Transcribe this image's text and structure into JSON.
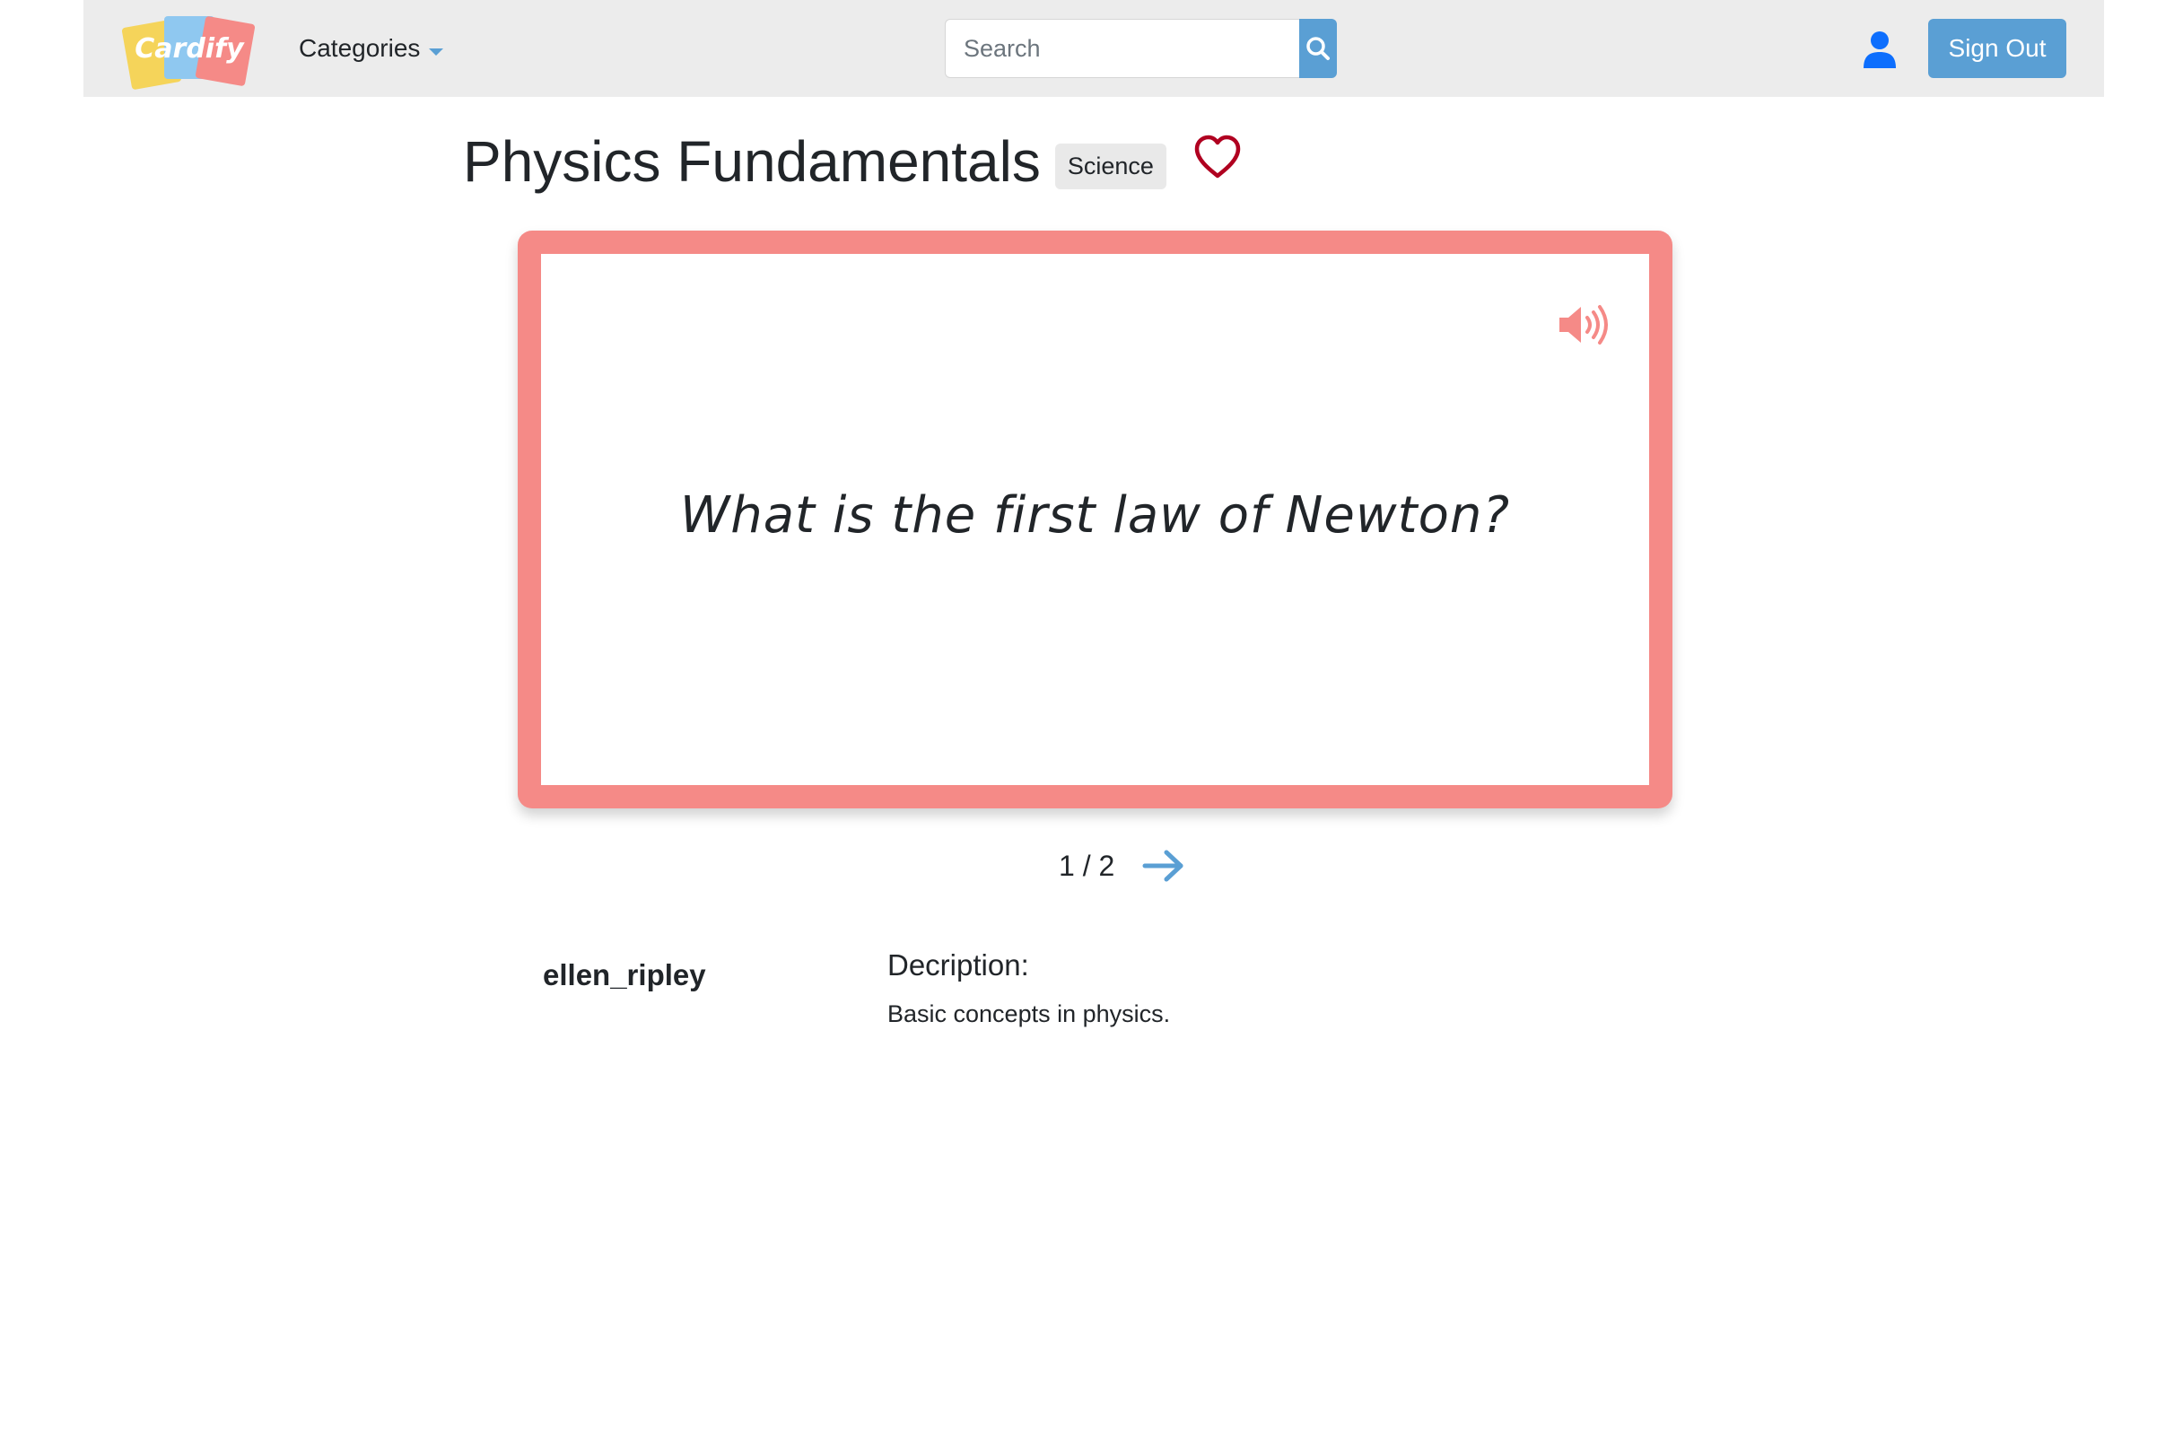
{
  "navbar": {
    "logo_text": "Cardify",
    "categories_label": "Categories",
    "search": {
      "placeholder": "Search",
      "value": ""
    },
    "icons": {
      "search": "search-icon",
      "user": "user-icon"
    },
    "sign_out_label": "Sign Out"
  },
  "deck": {
    "title": "Physics Fundamentals",
    "category_badge": "Science",
    "favorite_icon": "heart-outline-icon"
  },
  "card": {
    "question": "What is the first law of Newton?",
    "audio_icon": "speaker-icon"
  },
  "pager": {
    "count": "1 / 2",
    "next_icon": "arrow-right-icon"
  },
  "info": {
    "author": "ellen_ripley",
    "description_label": "Decription:",
    "description_text": "Basic concepts in physics."
  },
  "colors": {
    "accent_blue": "#5a9fd4",
    "card_border": "#f58a87",
    "heart_red": "#b00020",
    "user_icon": "#0d6efd",
    "navbar_bg": "#ececec",
    "logo_yellow": "#f5d45a",
    "logo_blue": "#8fc8f0",
    "logo_pink": "#f58a87"
  }
}
